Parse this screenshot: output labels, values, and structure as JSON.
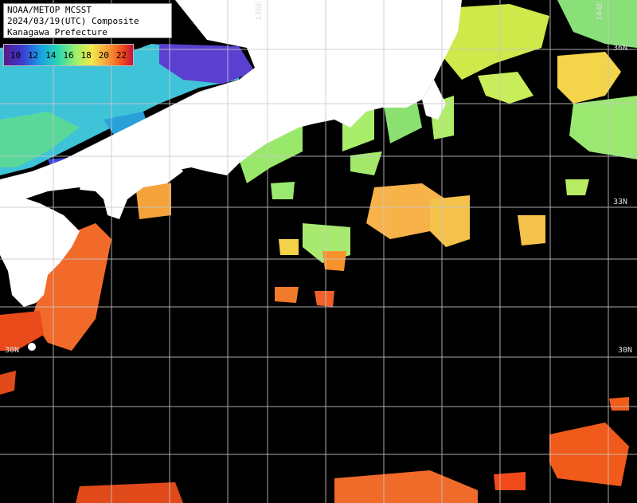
{
  "title": {
    "line1": "NOAA/METOP MCSST",
    "line2": "2024/03/19(UTC) Composite",
    "line3": "Kanagawa Prefecture"
  },
  "legend": {
    "ticks": [
      "10",
      "12",
      "14",
      "16",
      "18",
      "20",
      "22"
    ],
    "colors": [
      "#5a1a8a",
      "#3a3ad0",
      "#1a9ee6",
      "#29d8b0",
      "#9ef06a",
      "#f4e84a",
      "#f7a13a",
      "#f04a1a",
      "#c4123c"
    ]
  },
  "grid_labels": {
    "lon_136": "136E",
    "lon_144": "144E",
    "lat_36": "36N",
    "lat_33": "33N",
    "lat_30_left": "30N",
    "lat_30_right": "30N"
  },
  "colors": {
    "land": "#ffffff",
    "no_data": "#000000",
    "grid": "#c8c8c8"
  }
}
